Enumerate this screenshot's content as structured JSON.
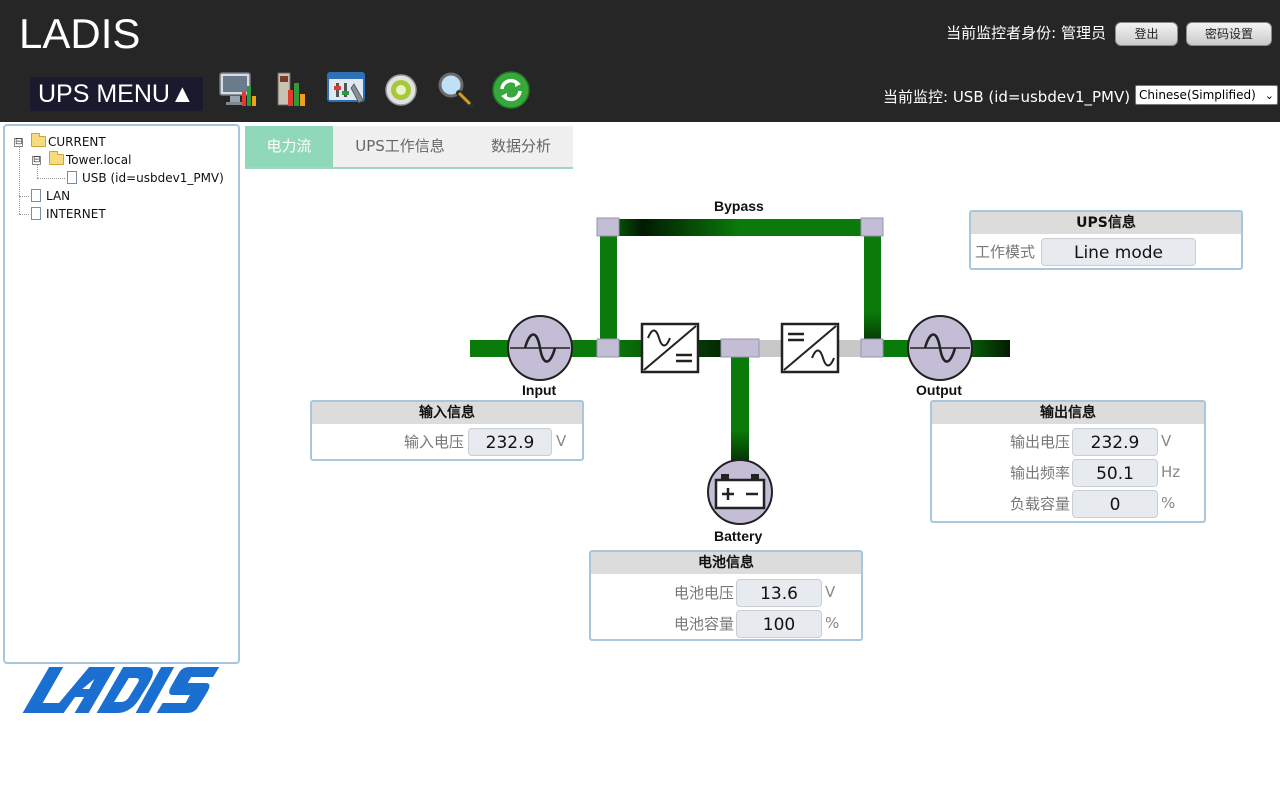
{
  "header": {
    "brand": "LADIS",
    "identity_text": "当前监控者身份: 管理员",
    "logout_label": "登出",
    "password_label": "密码设置",
    "ups_menu_label": "UPS MENU▲",
    "monitor_text": "当前监控: USB (id=usbdev1_PMV)",
    "language_selected": "Chinese(Simplified)",
    "toolbar_icons": [
      "monitor-chart-icon",
      "report-icon",
      "settings-panel-icon",
      "gear-icon",
      "magnifier-icon",
      "refresh-icon"
    ]
  },
  "tree": {
    "items": [
      {
        "label": "CURRENT",
        "level": 0,
        "type": "folder",
        "expander": "⊟"
      },
      {
        "label": "Tower.local",
        "level": 1,
        "type": "folder",
        "expander": "⊟"
      },
      {
        "label": "USB (id=usbdev1_PMV)",
        "level": 2,
        "type": "doc"
      },
      {
        "label": "LAN",
        "level": 0,
        "type": "doc"
      },
      {
        "label": "INTERNET",
        "level": 0,
        "type": "doc"
      }
    ]
  },
  "tabs": [
    {
      "label": "电力流",
      "active": true
    },
    {
      "label": "UPS工作信息",
      "active": false
    },
    {
      "label": "数据分析",
      "active": false
    }
  ],
  "diagram": {
    "bypass_label": "Bypass",
    "input_label": "Input",
    "output_label": "Output",
    "battery_label": "Battery"
  },
  "ups_info": {
    "title": "UPS信息",
    "mode_label": "工作模式",
    "mode_value": "Line mode"
  },
  "input_info": {
    "title": "输入信息",
    "voltage_label": "输入电压",
    "voltage_value": "232.9",
    "voltage_unit": "V"
  },
  "output_info": {
    "title": "输出信息",
    "voltage_label": "输出电压",
    "voltage_value": "232.9",
    "voltage_unit": "V",
    "frequency_label": "输出频率",
    "frequency_value": "50.1",
    "frequency_unit": "Hz",
    "load_label": "负载容量",
    "load_value": "0",
    "load_unit": "%"
  },
  "battery_info": {
    "title": "电池信息",
    "voltage_label": "电池电压",
    "voltage_value": "13.6",
    "voltage_unit": "V",
    "capacity_label": "电池容量",
    "capacity_value": "100",
    "capacity_unit": "%"
  },
  "colors": {
    "header_bg": "#262626",
    "tab_active": "#8fd8b9",
    "flow_green": "#0a7a0a",
    "node_fill": "#c4bdd6",
    "panel_border": "#a9c7dc",
    "logo_blue": "#1a6fd0"
  }
}
